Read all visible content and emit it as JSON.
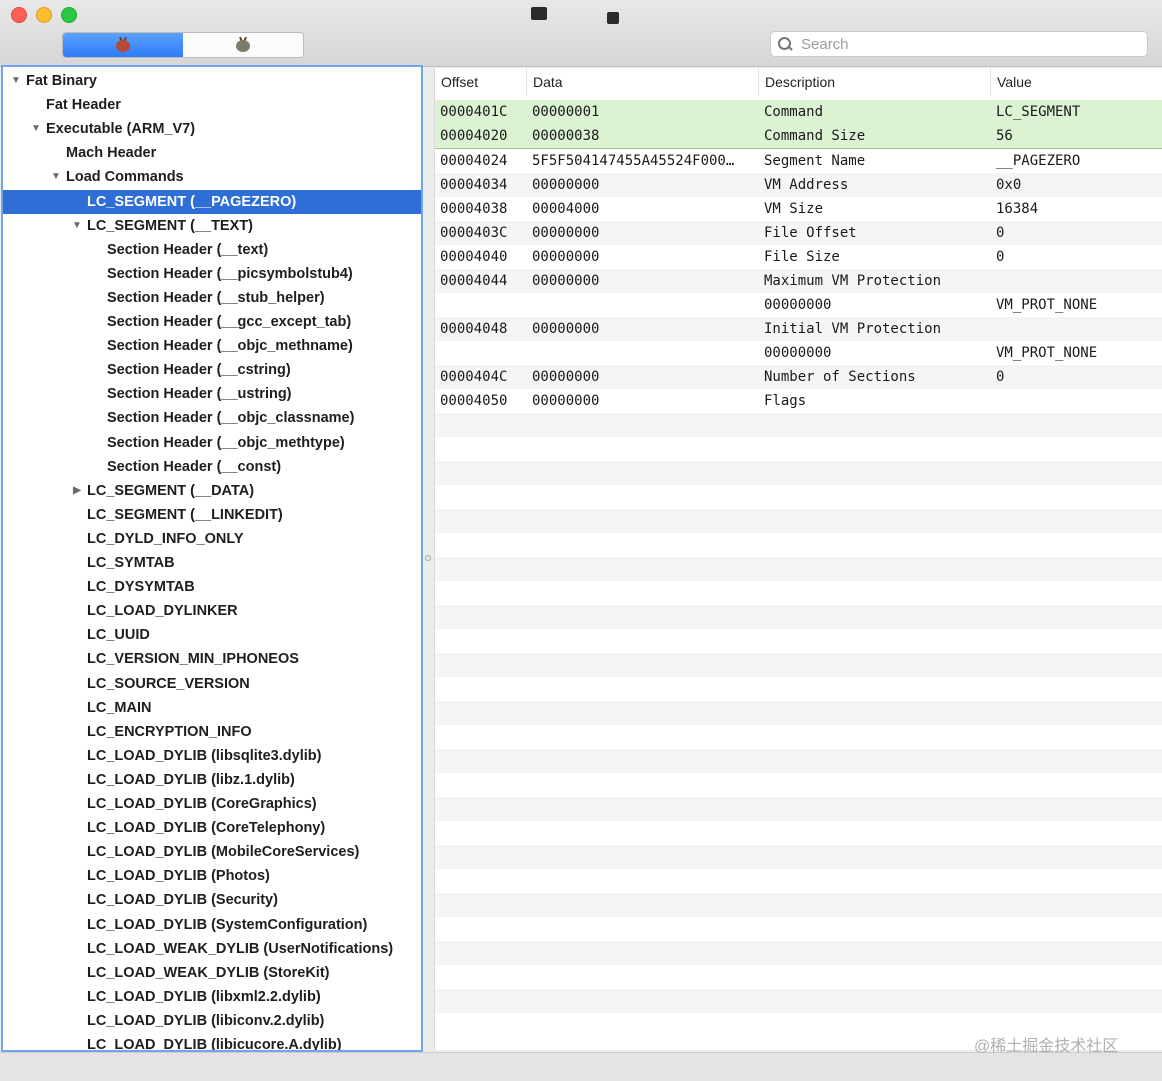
{
  "toolbar": {
    "search_placeholder": "Search"
  },
  "tree": {
    "items": [
      {
        "label": "Fat Binary",
        "level": 0,
        "expanded": true
      },
      {
        "label": "Fat Header",
        "level": 1
      },
      {
        "label": "Executable  (ARM_V7)",
        "level": 1,
        "expanded": true
      },
      {
        "label": "Mach Header",
        "level": 2
      },
      {
        "label": "Load Commands",
        "level": 2,
        "expanded": true
      },
      {
        "label": "LC_SEGMENT (__PAGEZERO)",
        "level": 3,
        "selected": true
      },
      {
        "label": "LC_SEGMENT (__TEXT)",
        "level": 3,
        "expanded": true
      },
      {
        "label": "Section Header (__text)",
        "level": 4
      },
      {
        "label": "Section Header (__picsymbolstub4)",
        "level": 4
      },
      {
        "label": "Section Header (__stub_helper)",
        "level": 4
      },
      {
        "label": "Section Header (__gcc_except_tab)",
        "level": 4
      },
      {
        "label": "Section Header (__objc_methname)",
        "level": 4
      },
      {
        "label": "Section Header (__cstring)",
        "level": 4
      },
      {
        "label": "Section Header (__ustring)",
        "level": 4
      },
      {
        "label": "Section Header (__objc_classname)",
        "level": 4
      },
      {
        "label": "Section Header (__objc_methtype)",
        "level": 4
      },
      {
        "label": "Section Header (__const)",
        "level": 4
      },
      {
        "label": "LC_SEGMENT (__DATA)",
        "level": 3,
        "expanded": false
      },
      {
        "label": "LC_SEGMENT (__LINKEDIT)",
        "level": 3
      },
      {
        "label": "LC_DYLD_INFO_ONLY",
        "level": 3
      },
      {
        "label": "LC_SYMTAB",
        "level": 3
      },
      {
        "label": "LC_DYSYMTAB",
        "level": 3
      },
      {
        "label": "LC_LOAD_DYLINKER",
        "level": 3
      },
      {
        "label": "LC_UUID",
        "level": 3
      },
      {
        "label": "LC_VERSION_MIN_IPHONEOS",
        "level": 3
      },
      {
        "label": "LC_SOURCE_VERSION",
        "level": 3
      },
      {
        "label": "LC_MAIN",
        "level": 3
      },
      {
        "label": "LC_ENCRYPTION_INFO",
        "level": 3
      },
      {
        "label": "LC_LOAD_DYLIB (libsqlite3.dylib)",
        "level": 3
      },
      {
        "label": "LC_LOAD_DYLIB (libz.1.dylib)",
        "level": 3
      },
      {
        "label": "LC_LOAD_DYLIB (CoreGraphics)",
        "level": 3
      },
      {
        "label": "LC_LOAD_DYLIB (CoreTelephony)",
        "level": 3
      },
      {
        "label": "LC_LOAD_DYLIB (MobileCoreServices)",
        "level": 3
      },
      {
        "label": "LC_LOAD_DYLIB (Photos)",
        "level": 3
      },
      {
        "label": "LC_LOAD_DYLIB (Security)",
        "level": 3
      },
      {
        "label": "LC_LOAD_DYLIB (SystemConfiguration)",
        "level": 3
      },
      {
        "label": "LC_LOAD_WEAK_DYLIB (UserNotifications)",
        "level": 3
      },
      {
        "label": "LC_LOAD_WEAK_DYLIB (StoreKit)",
        "level": 3
      },
      {
        "label": "LC_LOAD_DYLIB (libxml2.2.dylib)",
        "level": 3
      },
      {
        "label": "LC_LOAD_DYLIB (libiconv.2.dylib)",
        "level": 3
      },
      {
        "label": "LC_LOAD_DYLIB (libicucore.A.dylib)",
        "level": 3
      }
    ]
  },
  "table": {
    "columns": [
      "Offset",
      "Data",
      "Description",
      "Value"
    ],
    "rows": [
      {
        "offset": "0000401C",
        "data": "00000001",
        "desc": "Command",
        "value": "LC_SEGMENT",
        "highlight": true
      },
      {
        "offset": "00004020",
        "data": "00000038",
        "desc": "Command Size",
        "value": "56",
        "highlight": true
      },
      {
        "offset": "00004024",
        "data": "5F5F504147455A45524F000…",
        "desc": "Segment Name",
        "value": "__PAGEZERO"
      },
      {
        "offset": "00004034",
        "data": "00000000",
        "desc": "VM Address",
        "value": "0x0"
      },
      {
        "offset": "00004038",
        "data": "00004000",
        "desc": "VM Size",
        "value": "16384"
      },
      {
        "offset": "0000403C",
        "data": "00000000",
        "desc": "File Offset",
        "value": "0"
      },
      {
        "offset": "00004040",
        "data": "00000000",
        "desc": "File Size",
        "value": "0"
      },
      {
        "offset": "00004044",
        "data": "00000000",
        "desc": "Maximum VM Protection",
        "value": ""
      },
      {
        "offset": "",
        "data": "",
        "desc": "00000000",
        "value": "VM_PROT_NONE"
      },
      {
        "offset": "00004048",
        "data": "00000000",
        "desc": "Initial VM Protection",
        "value": ""
      },
      {
        "offset": "",
        "data": "",
        "desc": "00000000",
        "value": "VM_PROT_NONE"
      },
      {
        "offset": "0000404C",
        "data": "00000000",
        "desc": "Number of Sections",
        "value": "0"
      },
      {
        "offset": "00004050",
        "data": "00000000",
        "desc": "Flags",
        "value": ""
      }
    ]
  },
  "watermark": "@稀土掘金技术社区"
}
